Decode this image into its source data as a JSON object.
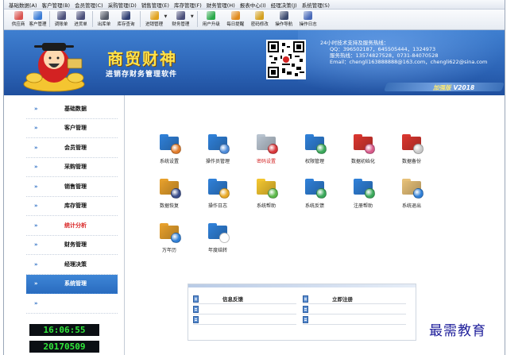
{
  "menu": [
    "基础数据(A)",
    "客户管理(B)",
    "会员管理(C)",
    "采购管理(D)",
    "销售管理(E)",
    "库存管理(F)",
    "财务管理(H)",
    "报表中心(I)",
    "经理决策(J)",
    "系统管理(S)"
  ],
  "toolbar": [
    {
      "label": "供应商",
      "icon": "supplier-icon",
      "color": "#d9534f"
    },
    {
      "label": "客户管理",
      "icon": "customer-icon",
      "color": "#3a7bd5"
    },
    {
      "label": "调账单",
      "icon": "adjust-doc-icon",
      "color": "#4a4f7a"
    },
    {
      "label": "进货单",
      "icon": "purchase-doc-icon",
      "color": "#4a4f7a"
    },
    {
      "label": "出库单",
      "icon": "outbound-doc-icon",
      "color": "#555b68"
    },
    {
      "label": "库存查询",
      "icon": "inventory-query-icon",
      "color": "#2f3f73"
    },
    {
      "label": "进销管理",
      "icon": "trade-icon",
      "color": "#e0a21e"
    },
    {
      "label": "财务管理",
      "icon": "finance-icon",
      "color": "#4a4f7a"
    },
    {
      "label": "用户升级",
      "icon": "upgrade-icon",
      "color": "#2aa84a"
    },
    {
      "label": "每日提醒",
      "icon": "reminder-icon",
      "color": "#e08a1e"
    },
    {
      "label": "密码修改",
      "icon": "password-icon",
      "color": "#d4a020"
    },
    {
      "label": "操作导航",
      "icon": "navigation-icon",
      "color": "#3c4a6e"
    },
    {
      "label": "操作日志",
      "icon": "log-icon",
      "color": "#4869b8"
    }
  ],
  "banner": {
    "title": "商贸财神",
    "subtitle": "进销存财务管理软件",
    "support_title": "24小时技术支持及服务热线：",
    "support_qq": "QQ：396502187，645505444，1324973",
    "support_phone": "服务热线：13574827528，0731-84070528",
    "support_email": "Email：chengli163888888@163.com，chengli622@sina.com",
    "edition": "加强版",
    "version": "V2018"
  },
  "sidebar": {
    "items": [
      {
        "label": "基础数据",
        "active": false,
        "red": false
      },
      {
        "label": "客户管理",
        "active": false,
        "red": false
      },
      {
        "label": "会员管理",
        "active": false,
        "red": false
      },
      {
        "label": "采购管理",
        "active": false,
        "red": false
      },
      {
        "label": "销售管理",
        "active": false,
        "red": false
      },
      {
        "label": "库存管理",
        "active": false,
        "red": false
      },
      {
        "label": "统计分析",
        "active": false,
        "red": true
      },
      {
        "label": "财务管理",
        "active": false,
        "red": false
      },
      {
        "label": "经理决策",
        "active": false,
        "red": false
      },
      {
        "label": "系统管理",
        "active": true,
        "red": false
      },
      {
        "label": "",
        "active": false,
        "red": false
      }
    ],
    "arrow": "»",
    "time": "16:06:55",
    "date": "20170509"
  },
  "main": {
    "icons": [
      {
        "label": "系统设置",
        "icon": "settings-icon",
        "folder": "#2f7fd6",
        "overlay": "#e07b2a",
        "red": false
      },
      {
        "label": "操作员管理",
        "icon": "operators-icon",
        "folder": "#2f7fd6",
        "overlay": "#4c8ad8",
        "red": false
      },
      {
        "label": "密码设置",
        "icon": "password-settings-icon",
        "folder": "#b8c3cf",
        "overlay": "#d8363a",
        "red": true
      },
      {
        "label": "权限管理",
        "icon": "permissions-icon",
        "folder": "#2f7fd6",
        "overlay": "#3aa85a",
        "red": false
      },
      {
        "label": "数据初始化",
        "icon": "data-init-icon",
        "folder": "#d8362f",
        "overlay": "#d85a8a",
        "red": false
      },
      {
        "label": "数据备份",
        "icon": "data-backup-icon",
        "folder": "#d8362f",
        "overlay": "#c9c9c9",
        "red": false
      },
      {
        "label": "数据恢复",
        "icon": "data-restore-icon",
        "folder": "#e6a02c",
        "overlay": "#3a4d8a",
        "red": false
      },
      {
        "label": "操作日志",
        "icon": "operation-log-icon",
        "folder": "#2f7fd6",
        "overlay": "#e8a826",
        "red": false
      },
      {
        "label": "系统帮助",
        "icon": "system-help-icon",
        "folder": "#f2c530",
        "overlay": "#5cb84a",
        "red": false
      },
      {
        "label": "系统反馈",
        "icon": "system-feedback-icon",
        "folder": "#2f7fd6",
        "overlay": "#3aa85a",
        "red": false
      },
      {
        "label": "注册帮助",
        "icon": "register-help-icon",
        "folder": "#2f7fd6",
        "overlay": "#3aa85a",
        "red": false
      },
      {
        "label": "系统退出",
        "icon": "exit-icon",
        "folder": "#e6c078",
        "overlay": "#2f7fd6",
        "red": false
      },
      {
        "label": "万年历",
        "icon": "calendar-icon",
        "folder": "#e6a02c",
        "overlay": "#2f7fd6",
        "red": false
      },
      {
        "label": "年度结转",
        "icon": "year-end-icon",
        "folder": "#2f7fd6",
        "overlay": "#ffffff",
        "red": false
      }
    ],
    "notice": {
      "left_title": "信息反馈",
      "right_title": "立即注册"
    }
  },
  "watermark": "最需教育"
}
